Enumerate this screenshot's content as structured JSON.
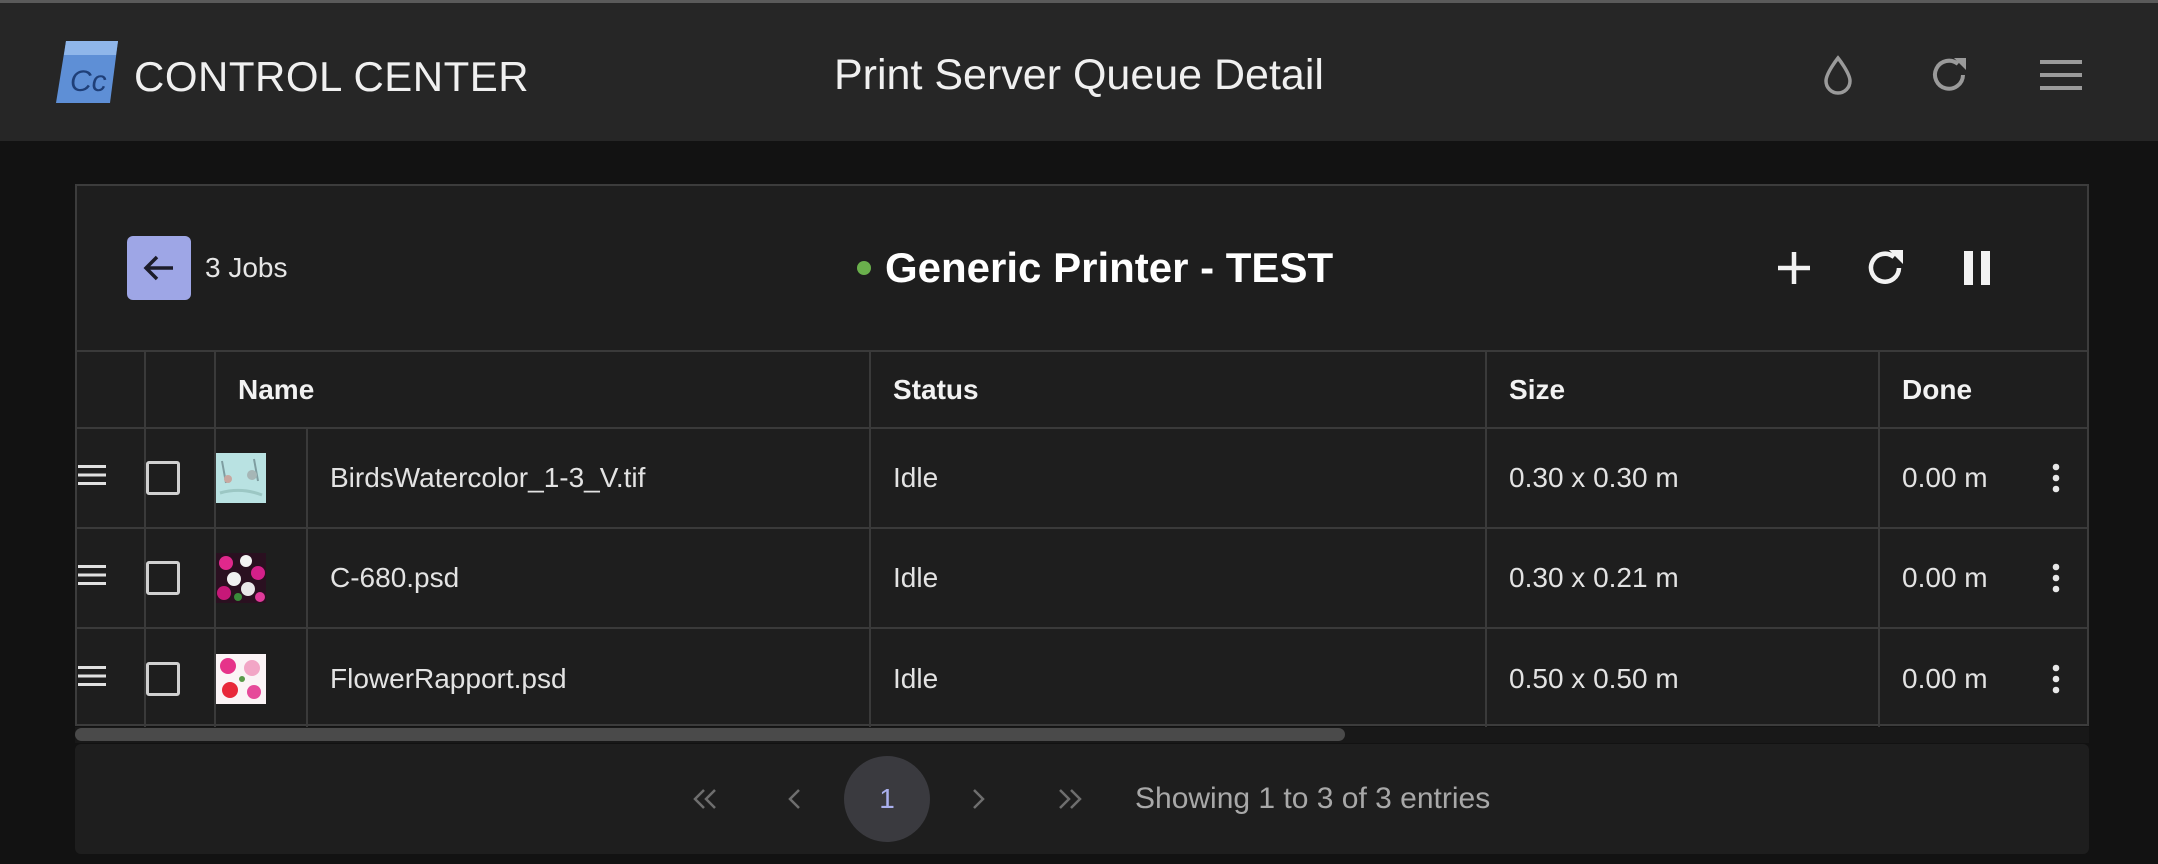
{
  "header": {
    "logo_text": "Cc",
    "brand": "CONTROL CENTER",
    "title": "Print Server Queue Detail",
    "icons": [
      "ink-drop-icon",
      "refresh-icon",
      "menu-icon"
    ]
  },
  "queue": {
    "jobs_label": "3 Jobs",
    "printer_name": "Generic Printer - TEST",
    "status_color": "#6ab04c",
    "back_button_color": "#9ea6e6",
    "actions": [
      "add-icon",
      "refresh-icon",
      "pause-icon"
    ]
  },
  "table": {
    "columns": [
      "",
      "",
      "Name",
      "Status",
      "Size",
      "Done"
    ],
    "rows": [
      {
        "name": "BirdsWatercolor_1-3_V.tif",
        "status": "Idle",
        "size": "0.30 x 0.30 m",
        "done": "0.00 m",
        "thumb": "watercolor-birds"
      },
      {
        "name": "C-680.psd",
        "status": "Idle",
        "size": "0.30 x 0.21 m",
        "done": "0.00 m",
        "thumb": "dark-flowers"
      },
      {
        "name": "FlowerRapport.psd",
        "status": "Idle",
        "size": "0.50 x 0.50 m",
        "done": "0.00 m",
        "thumb": "pink-flowers"
      }
    ]
  },
  "pagination": {
    "current_page": "1",
    "info": "Showing 1 to 3 of 3 entries"
  }
}
